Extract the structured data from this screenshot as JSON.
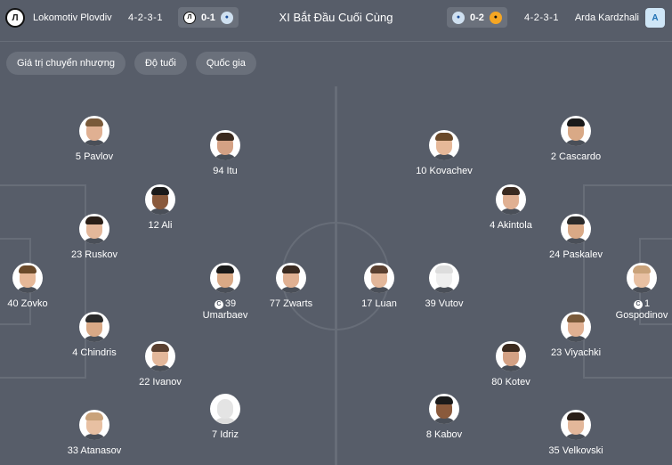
{
  "header": {
    "title": "XI Bắt Đầu Cuối Cùng",
    "home_team": "Lokomotiv Plovdiv",
    "home_formation": "4-2-3-1",
    "home_score": "0-1",
    "away_team": "Arda Kardzhali",
    "away_formation": "4-2-3-1",
    "away_score": "0-2",
    "home_crest_text": "Л",
    "away_crest_text": "A"
  },
  "tabs": [
    "Giá trị chuyển nhượng",
    "Độ tuổi",
    "Quốc gia"
  ],
  "home_players": [
    {
      "label": "5 Pavlov"
    },
    {
      "label": "94 Itu"
    },
    {
      "label": "12 Ali"
    },
    {
      "label": "23 Ruskov"
    },
    {
      "label": "40 Zovko"
    },
    {
      "label": "39",
      "label2": "Umarbaev",
      "captain": "C"
    },
    {
      "label": "77 Zwarts"
    },
    {
      "label": "4 Chindris"
    },
    {
      "label": "22 Ivanov"
    },
    {
      "label": "7 Idriz"
    },
    {
      "label": "33 Atanasov"
    }
  ],
  "away_players": [
    {
      "label": "10 Kovachev"
    },
    {
      "label": "2 Cascardo"
    },
    {
      "label": "4 Akintola"
    },
    {
      "label": "24 Paskalev"
    },
    {
      "label": "17 Luan"
    },
    {
      "label": "39 Vutov"
    },
    {
      "label": "1",
      "label2": "Gospodinov",
      "captain": "C"
    },
    {
      "label": "23 Viyachki"
    },
    {
      "label": "80 Kotev"
    },
    {
      "label": "8 Kabov"
    },
    {
      "label": "35 Velkovski"
    }
  ],
  "colors": {
    "background": "#575d69",
    "pill": "#6a707b",
    "lines": "#676d78"
  }
}
